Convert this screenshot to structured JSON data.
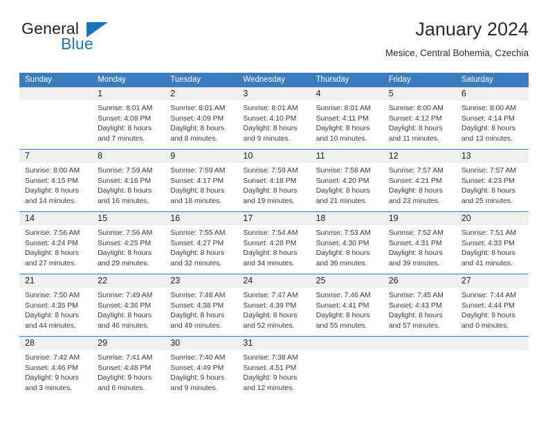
{
  "brand": {
    "name_part1": "General",
    "name_part2": "Blue",
    "triangle_color": "#1b75bb",
    "text_color": "#231f20"
  },
  "header": {
    "title": "January 2024",
    "subtitle": "Mesice, Central Bohemia, Czechia"
  },
  "theme": {
    "header_blue": "#3b7dbf",
    "day_band_gray": "#efefef",
    "text_color": "#3a3a3a"
  },
  "weekdays": [
    "Sunday",
    "Monday",
    "Tuesday",
    "Wednesday",
    "Thursday",
    "Friday",
    "Saturday"
  ],
  "weeks": [
    [
      {
        "day": "",
        "lines": [
          "",
          "",
          "",
          ""
        ],
        "empty": true
      },
      {
        "day": "1",
        "lines": [
          "Sunrise: 8:01 AM",
          "Sunset: 4:08 PM",
          "Daylight: 8 hours",
          "and 7 minutes."
        ]
      },
      {
        "day": "2",
        "lines": [
          "Sunrise: 8:01 AM",
          "Sunset: 4:09 PM",
          "Daylight: 8 hours",
          "and 8 minutes."
        ]
      },
      {
        "day": "3",
        "lines": [
          "Sunrise: 8:01 AM",
          "Sunset: 4:10 PM",
          "Daylight: 8 hours",
          "and 9 minutes."
        ]
      },
      {
        "day": "4",
        "lines": [
          "Sunrise: 8:01 AM",
          "Sunset: 4:11 PM",
          "Daylight: 8 hours",
          "and 10 minutes."
        ]
      },
      {
        "day": "5",
        "lines": [
          "Sunrise: 8:00 AM",
          "Sunset: 4:12 PM",
          "Daylight: 8 hours",
          "and 11 minutes."
        ]
      },
      {
        "day": "6",
        "lines": [
          "Sunrise: 8:00 AM",
          "Sunset: 4:14 PM",
          "Daylight: 8 hours",
          "and 13 minutes."
        ]
      }
    ],
    [
      {
        "day": "7",
        "lines": [
          "Sunrise: 8:00 AM",
          "Sunset: 4:15 PM",
          "Daylight: 8 hours",
          "and 14 minutes."
        ]
      },
      {
        "day": "8",
        "lines": [
          "Sunrise: 7:59 AM",
          "Sunset: 4:16 PM",
          "Daylight: 8 hours",
          "and 16 minutes."
        ]
      },
      {
        "day": "9",
        "lines": [
          "Sunrise: 7:59 AM",
          "Sunset: 4:17 PM",
          "Daylight: 8 hours",
          "and 18 minutes."
        ]
      },
      {
        "day": "10",
        "lines": [
          "Sunrise: 7:59 AM",
          "Sunset: 4:18 PM",
          "Daylight: 8 hours",
          "and 19 minutes."
        ]
      },
      {
        "day": "11",
        "lines": [
          "Sunrise: 7:58 AM",
          "Sunset: 4:20 PM",
          "Daylight: 8 hours",
          "and 21 minutes."
        ]
      },
      {
        "day": "12",
        "lines": [
          "Sunrise: 7:57 AM",
          "Sunset: 4:21 PM",
          "Daylight: 8 hours",
          "and 23 minutes."
        ]
      },
      {
        "day": "13",
        "lines": [
          "Sunrise: 7:57 AM",
          "Sunset: 4:23 PM",
          "Daylight: 8 hours",
          "and 25 minutes."
        ]
      }
    ],
    [
      {
        "day": "14",
        "lines": [
          "Sunrise: 7:56 AM",
          "Sunset: 4:24 PM",
          "Daylight: 8 hours",
          "and 27 minutes."
        ]
      },
      {
        "day": "15",
        "lines": [
          "Sunrise: 7:56 AM",
          "Sunset: 4:25 PM",
          "Daylight: 8 hours",
          "and 29 minutes."
        ]
      },
      {
        "day": "16",
        "lines": [
          "Sunrise: 7:55 AM",
          "Sunset: 4:27 PM",
          "Daylight: 8 hours",
          "and 32 minutes."
        ]
      },
      {
        "day": "17",
        "lines": [
          "Sunrise: 7:54 AM",
          "Sunset: 4:28 PM",
          "Daylight: 8 hours",
          "and 34 minutes."
        ]
      },
      {
        "day": "18",
        "lines": [
          "Sunrise: 7:53 AM",
          "Sunset: 4:30 PM",
          "Daylight: 8 hours",
          "and 36 minutes."
        ]
      },
      {
        "day": "19",
        "lines": [
          "Sunrise: 7:52 AM",
          "Sunset: 4:31 PM",
          "Daylight: 8 hours",
          "and 39 minutes."
        ]
      },
      {
        "day": "20",
        "lines": [
          "Sunrise: 7:51 AM",
          "Sunset: 4:33 PM",
          "Daylight: 8 hours",
          "and 41 minutes."
        ]
      }
    ],
    [
      {
        "day": "21",
        "lines": [
          "Sunrise: 7:50 AM",
          "Sunset: 4:35 PM",
          "Daylight: 8 hours",
          "and 44 minutes."
        ]
      },
      {
        "day": "22",
        "lines": [
          "Sunrise: 7:49 AM",
          "Sunset: 4:36 PM",
          "Daylight: 8 hours",
          "and 46 minutes."
        ]
      },
      {
        "day": "23",
        "lines": [
          "Sunrise: 7:48 AM",
          "Sunset: 4:38 PM",
          "Daylight: 8 hours",
          "and 49 minutes."
        ]
      },
      {
        "day": "24",
        "lines": [
          "Sunrise: 7:47 AM",
          "Sunset: 4:39 PM",
          "Daylight: 8 hours",
          "and 52 minutes."
        ]
      },
      {
        "day": "25",
        "lines": [
          "Sunrise: 7:46 AM",
          "Sunset: 4:41 PM",
          "Daylight: 8 hours",
          "and 55 minutes."
        ]
      },
      {
        "day": "26",
        "lines": [
          "Sunrise: 7:45 AM",
          "Sunset: 4:43 PM",
          "Daylight: 8 hours",
          "and 57 minutes."
        ]
      },
      {
        "day": "27",
        "lines": [
          "Sunrise: 7:44 AM",
          "Sunset: 4:44 PM",
          "Daylight: 9 hours",
          "and 0 minutes."
        ]
      }
    ],
    [
      {
        "day": "28",
        "lines": [
          "Sunrise: 7:42 AM",
          "Sunset: 4:46 PM",
          "Daylight: 9 hours",
          "and 3 minutes."
        ]
      },
      {
        "day": "29",
        "lines": [
          "Sunrise: 7:41 AM",
          "Sunset: 4:48 PM",
          "Daylight: 9 hours",
          "and 6 minutes."
        ]
      },
      {
        "day": "30",
        "lines": [
          "Sunrise: 7:40 AM",
          "Sunset: 4:49 PM",
          "Daylight: 9 hours",
          "and 9 minutes."
        ]
      },
      {
        "day": "31",
        "lines": [
          "Sunrise: 7:38 AM",
          "Sunset: 4:51 PM",
          "Daylight: 9 hours",
          "and 12 minutes."
        ]
      },
      {
        "day": "",
        "lines": [
          "",
          "",
          "",
          ""
        ],
        "empty": true
      },
      {
        "day": "",
        "lines": [
          "",
          "",
          "",
          ""
        ],
        "empty": true
      },
      {
        "day": "",
        "lines": [
          "",
          "",
          "",
          ""
        ],
        "empty": true
      }
    ]
  ]
}
